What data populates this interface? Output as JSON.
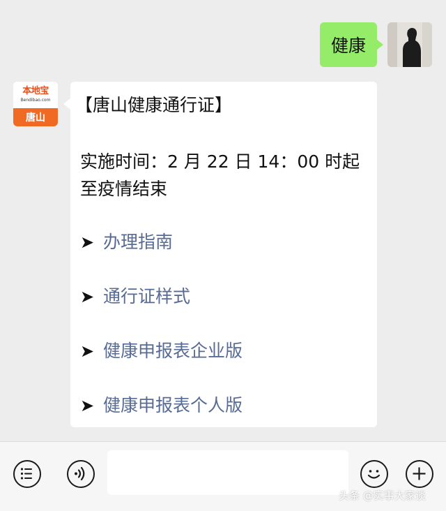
{
  "outgoing": {
    "text": "健康"
  },
  "incoming": {
    "avatar": {
      "logo": "本地宝",
      "logo_sub": "Bendibao.com",
      "city": "唐山"
    },
    "title": "【唐山健康通行证】",
    "body": "实施时间：2 月 22 日 14：00 时起至疫情结束",
    "links": [
      {
        "arrow": "➤",
        "label": "办理指南"
      },
      {
        "arrow": "➤",
        "label": "通行证样式"
      },
      {
        "arrow": "➤",
        "label": "健康申报表企业版"
      },
      {
        "arrow": "➤",
        "label": "健康申报表个人版"
      }
    ]
  },
  "toolbar": {
    "icons": [
      "menu-icon",
      "voice-icon",
      "emoji-icon",
      "plus-icon"
    ],
    "input_value": ""
  },
  "watermark": "头条 @实事大家谈",
  "colors": {
    "background": "#ededed",
    "outgoing_bubble": "#95ec69",
    "link": "#576b95",
    "logo_orange": "#f06a24"
  }
}
